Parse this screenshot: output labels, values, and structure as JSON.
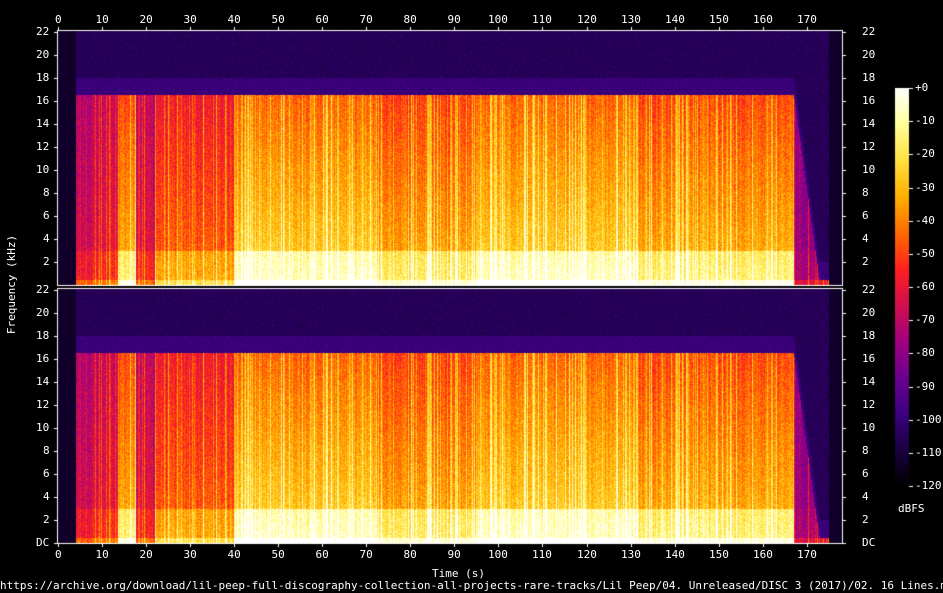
{
  "chart_data": {
    "type": "heatmap",
    "subtype": "spectrogram",
    "xlabel": "Time (s)",
    "ylabel": "Frequency (kHz)",
    "x_range": [
      0,
      178
    ],
    "x_ticks": [
      0,
      10,
      20,
      30,
      40,
      50,
      60,
      70,
      80,
      90,
      100,
      110,
      120,
      130,
      140,
      150,
      160,
      170
    ],
    "channels": [
      {
        "y_ticks": [
          "2",
          "4",
          "6",
          "8",
          "10",
          "12",
          "14",
          "16",
          "18",
          "20",
          "22"
        ]
      },
      {
        "y_ticks": [
          "DC",
          "2",
          "4",
          "6",
          "8",
          "10",
          "12",
          "14",
          "16",
          "18",
          "20",
          "22"
        ]
      }
    ],
    "y_range_khz": [
      0,
      22.05
    ],
    "colorbar": {
      "label": "dBFS",
      "range": [
        -120,
        0
      ],
      "ticks": [
        "+0",
        "-10",
        "-20",
        "-30",
        "-40",
        "-50",
        "-60",
        "-70",
        "-80",
        "-90",
        "-100",
        "-110",
        "-120"
      ],
      "colors": [
        "#000000",
        "#1a0040",
        "#3c0080",
        "#6a0090",
        "#a00080",
        "#d01050",
        "#ff2020",
        "#ff6a00",
        "#ffb000",
        "#ffe040",
        "#ffff99",
        "#ffffff"
      ]
    },
    "audio": {
      "duration_s": 175,
      "signal_start_s": 4,
      "lowpass_end_s": 167,
      "lowpass_cutoff_khz": 16.5,
      "segments": [
        {
          "start": 4,
          "end": 13.5,
          "level": 0.35
        },
        {
          "start": 13.5,
          "end": 17.5,
          "level": 0.85
        },
        {
          "start": 17.5,
          "end": 22,
          "level": 0.35
        },
        {
          "start": 22,
          "end": 40,
          "level": 0.62
        },
        {
          "start": 40,
          "end": 72,
          "level": 0.95
        },
        {
          "start": 72,
          "end": 95,
          "level": 0.82
        },
        {
          "start": 95,
          "end": 131,
          "level": 0.95
        },
        {
          "start": 131,
          "end": 167,
          "level": 0.85
        },
        {
          "start": 167,
          "end": 175,
          "level": 0.15
        }
      ]
    }
  },
  "footer": {
    "source_path": "https://archive.org/download/lil-peep-full-discography-collection-all-projects-rare-tracks/Lil Peep/04. Unreleased/DISC 3 (2017)/02. 16 Lines.mp3"
  }
}
